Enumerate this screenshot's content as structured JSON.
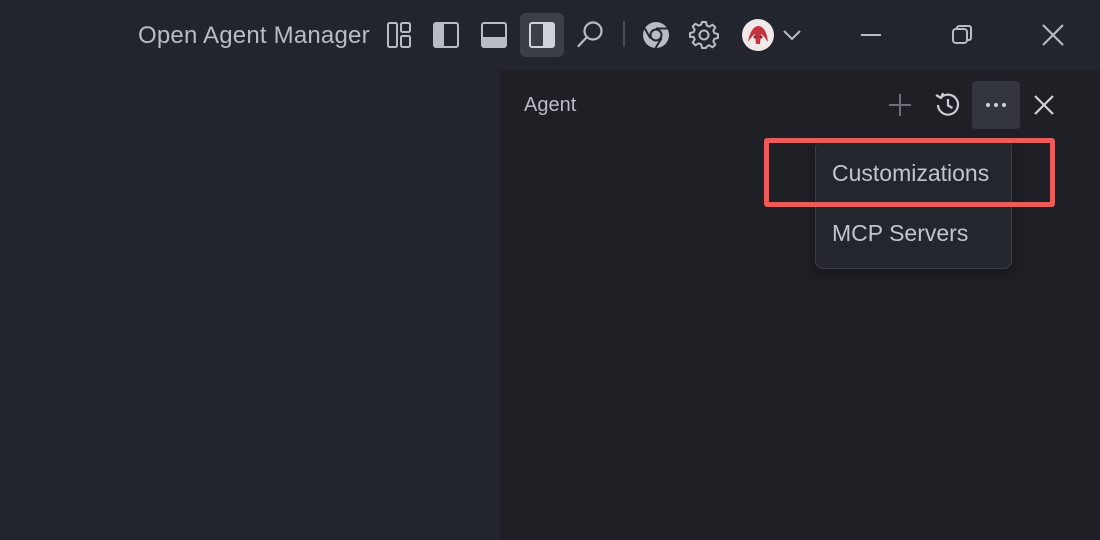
{
  "window": {
    "title": "Open Agent Manager"
  },
  "titlebar": {
    "icons": [
      "customize-layout-icon",
      "toggle-primary-sidebar-icon",
      "toggle-panel-icon",
      "toggle-secondary-sidebar-icon",
      "search-icon",
      "chrome-icon",
      "settings-gear-icon",
      "avatar",
      "chevron-down-icon",
      "minimize-icon",
      "restore-icon",
      "close-icon"
    ]
  },
  "agent_panel": {
    "title": "Agent",
    "actions": [
      "plus-icon",
      "history-icon",
      "more-icon",
      "close-icon"
    ]
  },
  "menu": {
    "items": [
      {
        "label": "Customizations"
      },
      {
        "label": "MCP Servers"
      }
    ]
  },
  "colors": {
    "background": "#22252d",
    "panel": "#1e2026",
    "highlight": "#ec5a5a",
    "active_button": "#3c3f47"
  }
}
